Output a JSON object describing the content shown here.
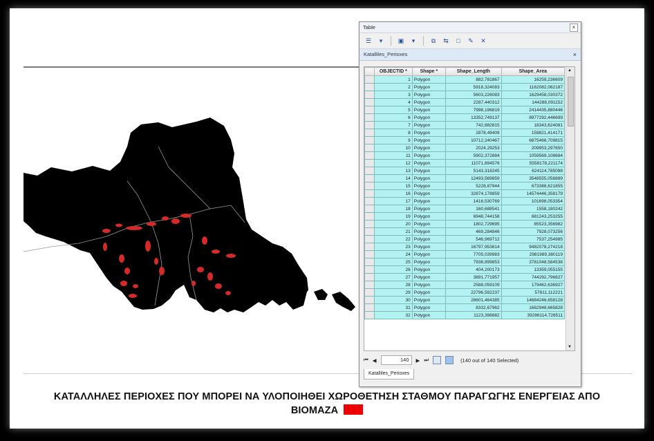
{
  "map": {
    "land_color": "#000000",
    "site_color": "#d42a2a"
  },
  "caption": {
    "line1": "ΚΑΤΑΛΛΗΛΕΣ ΠΕΡΙΟΧΕΣ ΠΟΥ ΜΠΟΡΕΙ ΝΑ ΥΛΟΠΟΙΗΘΕΙ ΧΩΡΟΘΕΤΗΣΗ ΣΤΑΘΜΟΥ ΠΑΡΑΓΩΓΗΣ ΕΝΕΡΓΕΙΑΣ ΑΠΟ",
    "line2": "ΒΙΟΜΑΖΑ",
    "legend_color": "#ee0000"
  },
  "table_window": {
    "title": "Table",
    "close_icon": "close-icon",
    "layer_tab": "Katalliles_Perioxes",
    "columns": [
      "OBJECTID *",
      "Shape *",
      "Shape_Length",
      "Shape_Area"
    ],
    "rows": [
      [
        "1",
        "Polygon",
        "882,781867",
        "16259,236609"
      ],
      [
        "2",
        "Polygon",
        "5918,324083",
        "1162082,062187"
      ],
      [
        "3",
        "Polygon",
        "5603,226083",
        "1629458,030372"
      ],
      [
        "4",
        "Polygon",
        "2287,440312",
        "144288,091152"
      ],
      [
        "5",
        "Polygon",
        "7998,196819",
        "2414435,880446"
      ],
      [
        "6",
        "Polygon",
        "13352,749137",
        "8977292,446699"
      ],
      [
        "7",
        "Polygon",
        "742,882815",
        "18343,624081"
      ],
      [
        "8",
        "Polygon",
        "2878,49409",
        "159821,414171"
      ],
      [
        "9",
        "Polygon",
        "10712,240467",
        "6875466,709815"
      ],
      [
        "10",
        "Polygon",
        "2024,29253",
        "209953,297650"
      ],
      [
        "11",
        "Polygon",
        "5902,372884",
        "1059569,108684"
      ],
      [
        "12",
        "Polygon",
        "11071,694576",
        "5558178,221174"
      ],
      [
        "13",
        "Polygon",
        "5143,318245",
        "624114,785098"
      ],
      [
        "14",
        "Polygon",
        "12493,569859",
        "3548555,058889"
      ],
      [
        "15",
        "Polygon",
        "5228,87944",
        "673388,621855"
      ],
      [
        "16",
        "Polygon",
        "32874,178859",
        "14574446,358179"
      ],
      [
        "17",
        "Polygon",
        "1416,530769",
        "101698,053354"
      ],
      [
        "18",
        "Polygon",
        "160,688541",
        "1558,180242"
      ],
      [
        "19",
        "Polygon",
        "6948,744158",
        "681243,253255"
      ],
      [
        "20",
        "Polygon",
        "1802,729695",
        "85523,356982"
      ],
      [
        "21",
        "Polygon",
        "469,284846",
        "7928,073256"
      ],
      [
        "22",
        "Polygon",
        "546,969712",
        "7537,254985"
      ],
      [
        "23",
        "Polygon",
        "16797,953814",
        "9482078,274218"
      ],
      [
        "24",
        "Polygon",
        "7705,039983",
        "2981989,380119"
      ],
      [
        "25",
        "Polygon",
        "7938,899853",
        "3781048,584538"
      ],
      [
        "26",
        "Polygon",
        "404,200173",
        "13359,055155"
      ],
      [
        "27",
        "Polygon",
        "3891,771957",
        "744292,796827"
      ],
      [
        "28",
        "Polygon",
        "2588,059109",
        "179462,636927"
      ],
      [
        "29",
        "Polygon",
        "22796,592237",
        "57811,112221"
      ],
      [
        "30",
        "Polygon",
        "28601,464385",
        "14684246,658128"
      ],
      [
        "31",
        "Polygon",
        "8332,67962",
        "1682948,665828"
      ],
      [
        "32",
        "Polygon",
        "1123,398882",
        "39286114,728511"
      ]
    ],
    "nav": {
      "first_label": "⏮",
      "prev_label": "◀",
      "record": "140",
      "next_label": "▶",
      "last_label": "⏭",
      "status": "(140 out of 140 Selected)"
    },
    "bottom_tab": "Katalliles_Perioxes"
  }
}
